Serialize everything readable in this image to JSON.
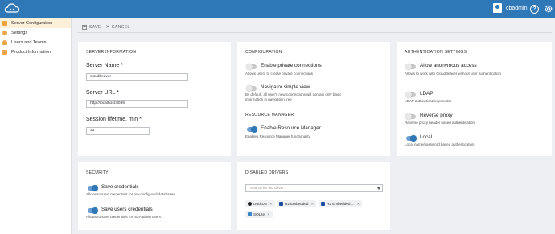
{
  "topbar": {
    "user_name": "cbadmin",
    "help_icon": "?",
    "settings_icon": "gear-icon"
  },
  "sidebar": {
    "items": [
      {
        "label": "Server Configuration",
        "icon": "server-icon",
        "active": true
      },
      {
        "label": "Settings",
        "icon": "gear-icon",
        "active": false
      },
      {
        "label": "Users and Teams",
        "icon": "users-icon",
        "active": false
      },
      {
        "label": "Product Information",
        "icon": "info-icon",
        "active": false
      }
    ]
  },
  "toolbar": {
    "save_label": "SAVE",
    "cancel_label": "CANCEL"
  },
  "server_info": {
    "title": "SERVER INFORMATION",
    "name_label": "Server Name *",
    "name_value": "cloudbeaver",
    "url_label": "Server URL *",
    "url_value": "http://localhost:8089",
    "lifetime_label": "Session lifetime, min *",
    "lifetime_value": "30"
  },
  "configuration": {
    "title": "CONFIGURATION",
    "private_title": "Enable private connections",
    "private_desc": "Allows users to create private connections",
    "private_on": false,
    "navigator_title": "Navigator simple view",
    "navigator_desc": "By default, all user's new connections will contain only basic information in navigation tree",
    "navigator_on": false,
    "rm_section": "RESOURCE MANAGER",
    "rm_title": "Enable Resource Manager",
    "rm_desc": "Enables Resource Manager functionality",
    "rm_on": true
  },
  "auth": {
    "title": "AUTHENTICATION SETTINGS",
    "anon_title": "Allow anonymous access",
    "anon_desc": "Allows to work with CloudBeaver without user authentication",
    "anon_on": false,
    "ldap_title": "LDAP",
    "ldap_desc": "LDAP authentication provider",
    "ldap_on": false,
    "proxy_title": "Reverse proxy",
    "proxy_desc": "Reverse proxy header based authentication",
    "proxy_on": false,
    "local_title": "Local",
    "local_desc": "Local name/password based authentication",
    "local_on": true
  },
  "security": {
    "title": "SECURITY",
    "creds_title": "Save credentials",
    "creds_desc": "Allows to save credentials for pre-configured databases",
    "creds_on": true,
    "user_creds_title": "Save users credentials",
    "user_creds_desc": "Allows to save credentials for non-admin users",
    "user_creds_on": true
  },
  "drivers": {
    "title": "DISABLED DRIVERS",
    "search_placeholder": "Search for the driver...",
    "chips": [
      {
        "label": "DuckDB",
        "color": "#222222"
      },
      {
        "label": "H2 Embedded",
        "color": "#1d4fa1"
      },
      {
        "label": "H2 Embedded ...",
        "color": "#1d4fa1"
      },
      {
        "label": "SQLite",
        "color": "#3a87c8"
      }
    ]
  }
}
